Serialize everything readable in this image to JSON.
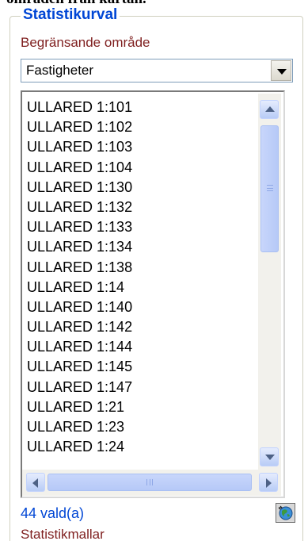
{
  "page_caption": "områden från kartan.",
  "group": {
    "title": "Statistikurval",
    "area_label": "Begränsande område",
    "area_select": {
      "selected": "Fastigheter"
    },
    "list_items": [
      "ULLARED 1:101",
      "ULLARED 1:102",
      "ULLARED 1:103",
      "ULLARED 1:104",
      "ULLARED 1:130",
      "ULLARED 1:132",
      "ULLARED 1:133",
      "ULLARED 1:134",
      "ULLARED 1:138",
      "ULLARED 1:14",
      "ULLARED 1:140",
      "ULLARED 1:142",
      "ULLARED 1:144",
      "ULLARED 1:145",
      "ULLARED 1:147",
      "ULLARED 1:21",
      "ULLARED 1:23",
      "ULLARED 1:24"
    ],
    "selected_count": "44 vald(a)",
    "templates_label": "Statistikmallar"
  },
  "colors": {
    "group_title": "#0046d5",
    "labels": "#7f1f1f",
    "count": "#0046d5"
  },
  "icons": {
    "map_button": "map-globe-icon"
  }
}
